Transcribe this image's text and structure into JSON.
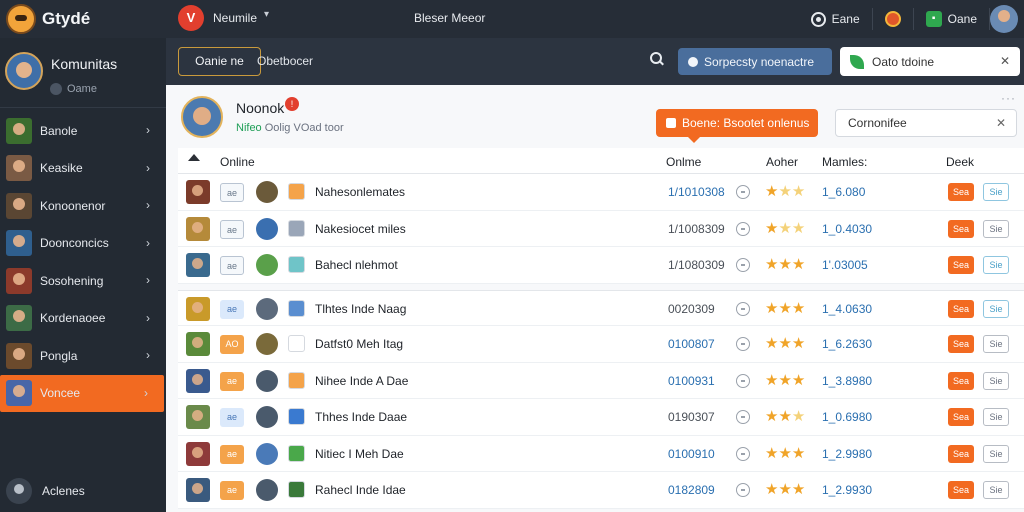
{
  "topbar": {
    "logo_text": "Gtydé",
    "app_name": "Neumile",
    "center_title": "Bleser Meeor",
    "items": [
      {
        "icon": "ring-icon",
        "label": "Eane"
      },
      {
        "icon": "orange-dot-icon",
        "label": ""
      },
      {
        "icon": "green-square-icon",
        "label": "Oane"
      }
    ]
  },
  "sidebar": {
    "community_title": "Komunitas",
    "community_sub": "Oame",
    "items": [
      {
        "label": "Banole",
        "color": "#3b6d2f"
      },
      {
        "label": "Keasike",
        "color": "#7a5a44"
      },
      {
        "label": "Konoonenor",
        "color": "#5a4633"
      },
      {
        "label": "Doonconcics",
        "color": "#2f5f8e"
      },
      {
        "label": "Sosohening",
        "color": "#8c3a2b"
      },
      {
        "label": "Kordenaoee",
        "color": "#3c6b46"
      },
      {
        "label": "Pongla",
        "color": "#6b4a2c"
      },
      {
        "label": "Voncee",
        "color": "#4866a8",
        "active": true
      }
    ],
    "bottom_label": "Aclenes"
  },
  "subbar": {
    "game_tab": "Oanie ne",
    "label": "Obetbocer",
    "search_pill": "Sorpecsty noenactre",
    "filter_text": "Oato tdoine"
  },
  "profile": {
    "name": "Noonok",
    "status_green": "Nifeo",
    "status_rest": "Oolig VOad toor",
    "tooltip": "Boene: Bsootet onlenus",
    "compare_box": "Cornonifee"
  },
  "table": {
    "headers": {
      "col1": "Online",
      "col2": "Onlme",
      "col3": "Aoher",
      "col4": "Mamles:",
      "col5": "Deek"
    },
    "rows": [
      {
        "thumb": "#7b3b2a",
        "chip": "ae",
        "chip_style": "outline",
        "icon": "#6b5a3a",
        "tag": "#f4a34a",
        "name": "Nahesonlemates",
        "online": "1/1010308",
        "online_style": "blue",
        "stars": 1,
        "value": "1_6.080",
        "btn1": "Sea",
        "btn2": "Sie",
        "btn2_style": "blue",
        "gap": false
      },
      {
        "thumb": "#b58a3a",
        "chip": "ae",
        "chip_style": "outline",
        "icon": "#3a6fb0",
        "tag": "#9aa6b8",
        "name": "Nakesiocet miles",
        "online": "1/1008309",
        "online_style": "dark",
        "stars": 1,
        "value": "1_0.4030",
        "btn1": "Sea",
        "btn2": "Sie",
        "btn2_style": "gray",
        "gap": false
      },
      {
        "thumb": "#3a6a8e",
        "chip": "ae",
        "chip_style": "outline",
        "icon": "#5aa04a",
        "tag": "#6fc4c8",
        "name": "Bahecl nlehmot",
        "online": "1/1080309",
        "online_style": "dark",
        "stars": 3,
        "value": "1'.03005",
        "btn1": "Sea",
        "btn2": "Sie",
        "btn2_style": "blue",
        "gap": false
      },
      {
        "thumb": "#c99a2a",
        "chip": "ae",
        "chip_style": "blue",
        "icon": "#5c6a7c",
        "tag": "#5a8ed0",
        "name": "Tlhtes Inde Naag",
        "online": "0020309",
        "online_style": "dark",
        "stars": 3,
        "value": "1_4.0630",
        "btn1": "Sea",
        "btn2": "Sie",
        "btn2_style": "blue",
        "gap": true
      },
      {
        "thumb": "#5a8a3a",
        "chip": "AO",
        "chip_style": "orange",
        "icon": "#7a6a3a",
        "tag": "#ffffff",
        "name": "Datfst0 Meh Itag",
        "online": "0100807",
        "online_style": "blue",
        "stars": 3,
        "value": "1_6.2630",
        "btn1": "Sea",
        "btn2": "Sie",
        "btn2_style": "gray",
        "gap": false
      },
      {
        "thumb": "#3a5a8e",
        "chip": "ae",
        "chip_style": "orange",
        "icon": "#4a5a6c",
        "tag": "#f4a34a",
        "name": "Nihee Inde A Dae",
        "online": "0100931",
        "online_style": "blue",
        "stars": 3,
        "value": "1_3.8980",
        "btn1": "Sea",
        "btn2": "Sie",
        "btn2_style": "gray",
        "gap": false
      },
      {
        "thumb": "#6a8a4a",
        "chip": "ae",
        "chip_style": "blue",
        "icon": "#4a5a6c",
        "tag": "#3a7ad0",
        "name": "Thhes Inde Daae",
        "online": "0190307",
        "online_style": "dark",
        "stars": 2,
        "value": "1_0.6980",
        "btn1": "Sea",
        "btn2": "Sie",
        "btn2_style": "gray",
        "gap": false
      },
      {
        "thumb": "#8e3a3a",
        "chip": "ae",
        "chip_style": "orange",
        "icon": "#4a7ab8",
        "tag": "#4aa84a",
        "name": "Nitiec I Meh Dae",
        "online": "0100910",
        "online_style": "blue",
        "stars": 3,
        "value": "1_2.9980",
        "btn1": "Sea",
        "btn2": "Sie",
        "btn2_style": "gray",
        "gap": false
      },
      {
        "thumb": "#3a5a7e",
        "chip": "ae",
        "chip_style": "orange",
        "icon": "#4a5a6c",
        "tag": "#3a7a3a",
        "name": "Rahecl Inde Idae",
        "online": "0182809",
        "online_style": "blue",
        "stars": 3,
        "value": "1_2.9930",
        "btn1": "Sea",
        "btn2": "Sie",
        "btn2_style": "gray",
        "gap": false
      }
    ]
  }
}
